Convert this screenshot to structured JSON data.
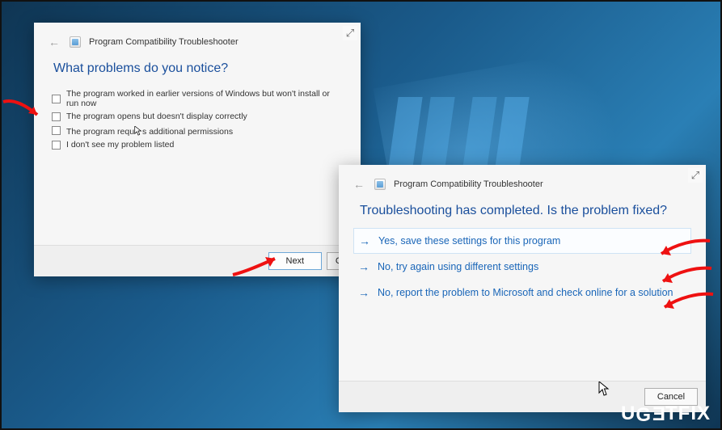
{
  "window1": {
    "header_title": "Program Compatibility Troubleshooter",
    "heading": "What problems do you notice?",
    "checks": [
      "The program worked in earlier versions of Windows but won't install or run now",
      "The program opens but doesn't display correctly",
      "The program requires additional permissions",
      "I don't see my problem listed"
    ],
    "next_label": "Next",
    "cancel_partial": "Can"
  },
  "window2": {
    "header_title": "Program Compatibility Troubleshooter",
    "heading": "Troubleshooting has completed.  Is the problem fixed?",
    "options": [
      "Yes, save these settings for this program",
      "No, try again using different settings",
      "No, report the problem to Microsoft and check online for a solution"
    ],
    "cancel_label": "Cancel"
  },
  "watermark": "UGETFIX"
}
